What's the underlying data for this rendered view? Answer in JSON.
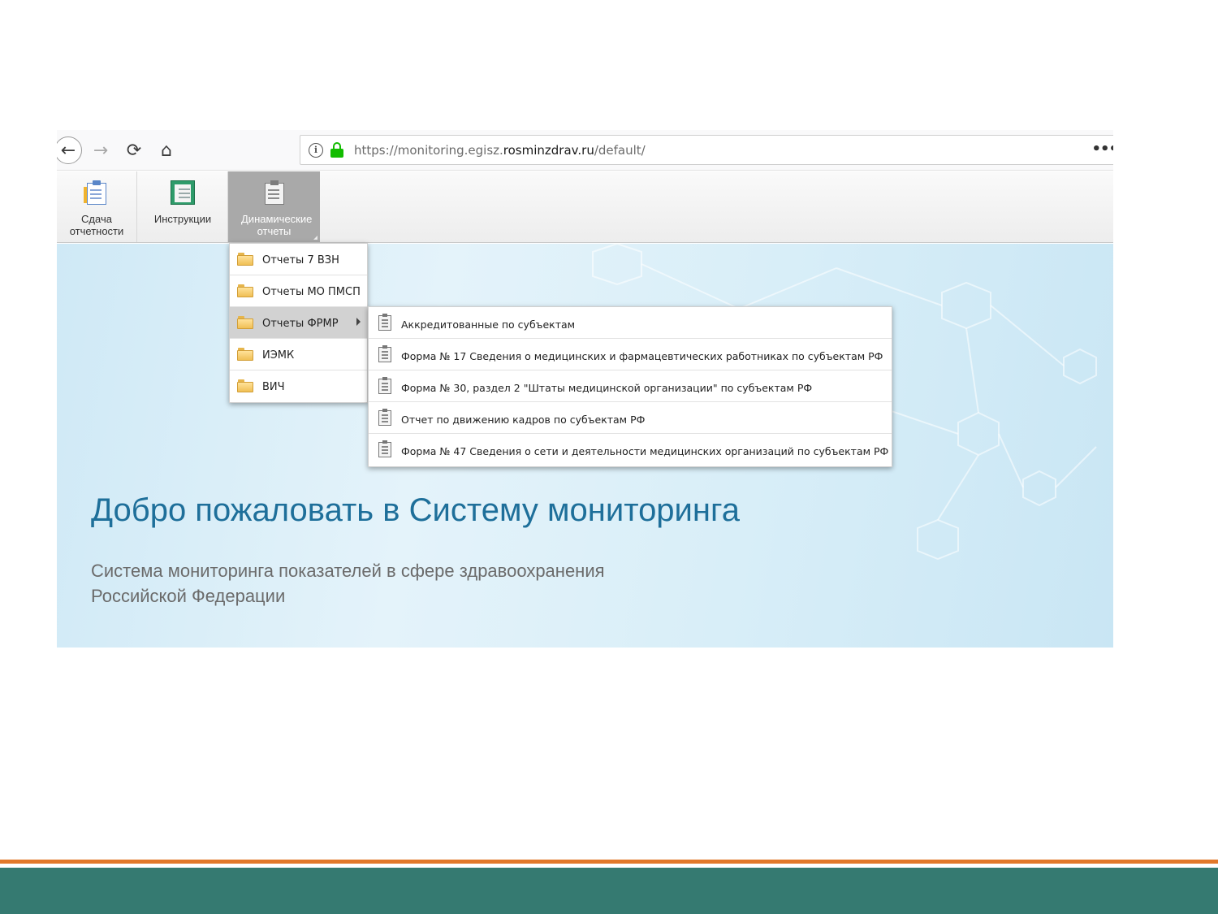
{
  "browser": {
    "url_scheme": "https://monitoring.egisz.",
    "url_host": "rosminzdrav.ru",
    "url_path": "/default/",
    "info_glyph": "i",
    "more_glyph": "•••",
    "back_glyph": "←",
    "forward_glyph": "→",
    "reload_glyph": "⟳",
    "home_glyph": "⌂"
  },
  "toolbar": {
    "reports_label": "Сдача отчетности",
    "instructions_label": "Инструкции",
    "dynamic_label": "Динамические отчеты"
  },
  "menu": {
    "items": [
      {
        "label": "Отчеты 7 ВЗН"
      },
      {
        "label": "Отчеты МО ПМСП"
      },
      {
        "label": "Отчеты ФРМР"
      },
      {
        "label": "ИЭМК"
      },
      {
        "label": "ВИЧ"
      }
    ],
    "submenu": [
      {
        "label": "Аккредитованные по субъектам"
      },
      {
        "label": "Форма № 17 Сведения о медицинских и фармацевтических работниках по субъектам РФ"
      },
      {
        "label": "Форма № 30, раздел 2 \"Штаты медицинской организации\" по субъектам РФ"
      },
      {
        "label": "Отчет по движению кадров по субъектам РФ"
      },
      {
        "label": "Форма № 47 Сведения о сети и деятельности медицинских организаций по субъектам РФ"
      }
    ]
  },
  "welcome": {
    "title": "Добро пожаловать в Систему мониторинга",
    "subtitle_line1": "Система мониторинга показателей в сфере здравоохранения",
    "subtitle_line2": "Российской Федерации"
  },
  "colors": {
    "title_blue": "#1e6f9a",
    "lock_green": "#12bc00",
    "footer_orange": "#e2792b",
    "footer_teal": "#357a71"
  }
}
